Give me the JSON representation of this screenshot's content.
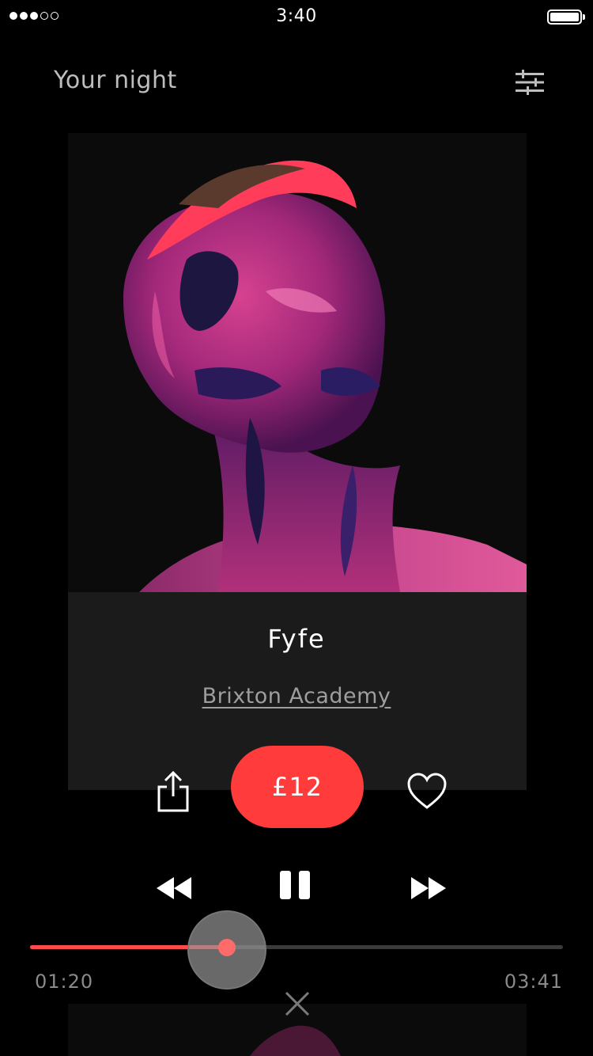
{
  "status_bar": {
    "time": "3:40",
    "signal_bars_filled": 3,
    "signal_bars_total": 5,
    "battery_level": 1.0
  },
  "header": {
    "title": "Your night",
    "filter_icon": "sliders-icon"
  },
  "event": {
    "artist": "Fyfe",
    "venue": "Brixton Academy",
    "price_label": "£12",
    "image_icon": "painted-face-artwork"
  },
  "actions": {
    "share_icon": "share-icon",
    "like_icon": "heart-icon"
  },
  "player": {
    "elapsed": "01:20",
    "total": "03:41",
    "progress": 0.37,
    "rewind_icon": "rewind-icon",
    "pause_icon": "pause-icon",
    "forward_icon": "fast-forward-icon",
    "close_icon": "close-icon"
  },
  "colors": {
    "accent": "#ff3b3b",
    "background": "#000000",
    "card": "#1b1b1b",
    "muted_text": "#9e9e9e"
  }
}
